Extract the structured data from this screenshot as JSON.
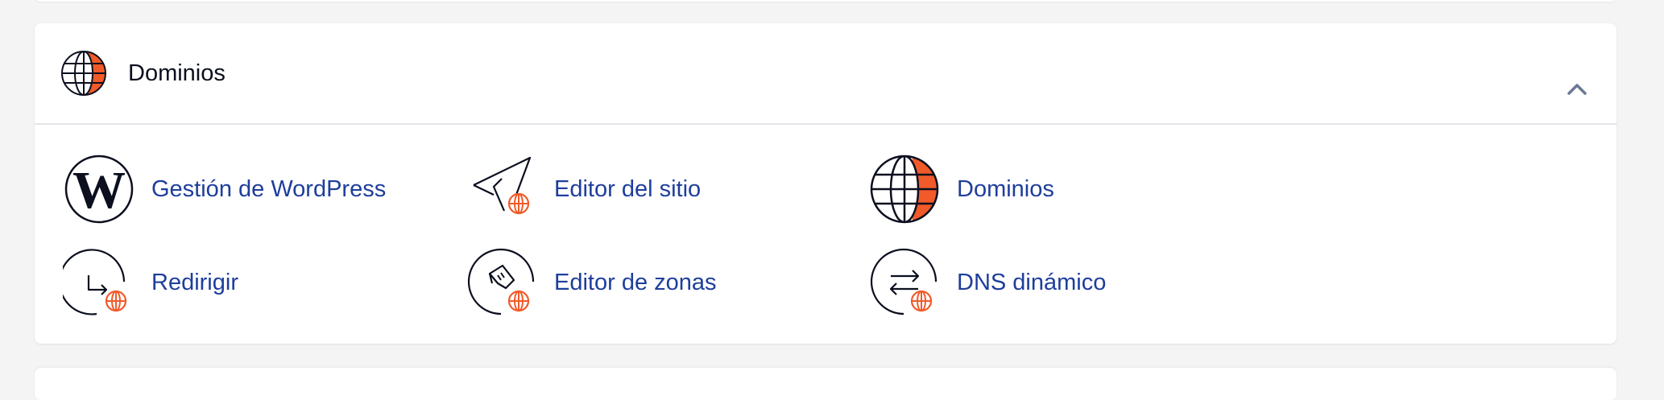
{
  "section": {
    "title": "Dominios",
    "icon": "globe-icon",
    "collapse_icon": "chevron-up-icon"
  },
  "tools": [
    {
      "label": "Gestión de WordPress",
      "icon": "wordpress-icon"
    },
    {
      "label": "Editor del sitio",
      "icon": "site-editor-icon"
    },
    {
      "label": "Dominios",
      "icon": "globe-icon"
    },
    {
      "label": "Redirigir",
      "icon": "redirect-icon"
    },
    {
      "label": "Editor de zonas",
      "icon": "zone-editor-icon"
    },
    {
      "label": "DNS dinámico",
      "icon": "dynamic-dns-icon"
    }
  ],
  "colors": {
    "accent": "#f15a29",
    "link": "#1e3e9c",
    "heading": "#0b0f1e",
    "divider": "#e3e4e8",
    "background": "#f4f4f5"
  }
}
